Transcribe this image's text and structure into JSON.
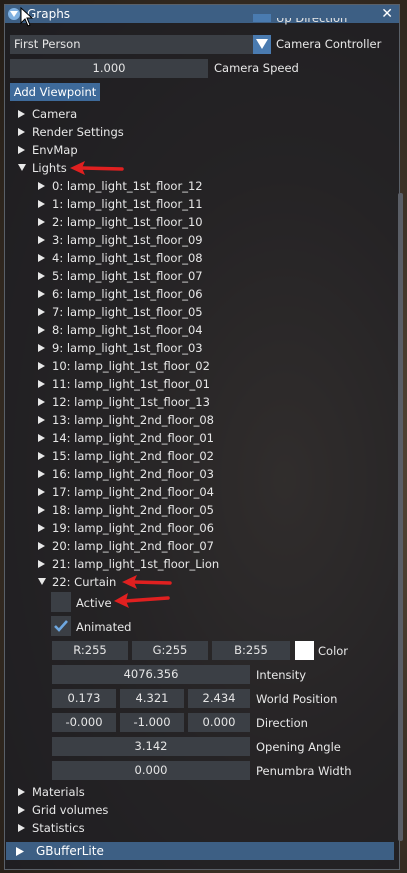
{
  "window": {
    "title": "Graphs",
    "close_glyph": "✕"
  },
  "top": {
    "up_direction_label": "Up Direction",
    "camera_controller_value": "First Person",
    "camera_controller_label": "Camera Controller",
    "camera_speed_value": "1.000",
    "camera_speed_label": "Camera Speed",
    "add_viewpoint_label": "Add Viewpoint"
  },
  "sections": {
    "camera": "Camera",
    "render_settings": "Render Settings",
    "envmap": "EnvMap",
    "lights": "Lights",
    "materials": "Materials",
    "grid_volumes": "Grid volumes",
    "statistics": "Statistics"
  },
  "lights": [
    "0: lamp_light_1st_floor_12",
    "1: lamp_light_1st_floor_11",
    "2: lamp_light_1st_floor_10",
    "3: lamp_light_1st_floor_09",
    "4: lamp_light_1st_floor_08",
    "5: lamp_light_1st_floor_07",
    "6: lamp_light_1st_floor_06",
    "7: lamp_light_1st_floor_05",
    "8: lamp_light_1st_floor_04",
    "9: lamp_light_1st_floor_03",
    "10: lamp_light_1st_floor_02",
    "11: lamp_light_1st_floor_01",
    "12: lamp_light_1st_floor_13",
    "13: lamp_light_2nd_floor_08",
    "14: lamp_light_2nd_floor_01",
    "15: lamp_light_2nd_floor_02",
    "16: lamp_light_2nd_floor_03",
    "17: lamp_light_2nd_floor_04",
    "18: lamp_light_2nd_floor_05",
    "19: lamp_light_2nd_floor_06",
    "20: lamp_light_2nd_floor_07",
    "21: lamp_light_1st_floor_Lion"
  ],
  "curtain": {
    "name": "22: Curtain",
    "active_label": "Active",
    "active_checked": false,
    "animated_label": "Animated",
    "animated_checked": true,
    "color_r": "R:255",
    "color_g": "G:255",
    "color_b": "B:255",
    "color_label": "Color",
    "color_swatch": "#ffffff",
    "intensity_value": "4076.356",
    "intensity_label": "Intensity",
    "world_position": [
      "0.173",
      "4.321",
      "2.434"
    ],
    "world_position_label": "World Position",
    "direction": [
      "-0.000",
      "-1.000",
      "0.000"
    ],
    "direction_label": "Direction",
    "opening_angle_value": "3.142",
    "opening_angle_label": "Opening Angle",
    "penumbra_width_value": "0.000",
    "penumbra_width_label": "Penumbra Width"
  },
  "bottom_panel": {
    "title": "GBufferLite"
  },
  "colors": {
    "title_bar": "#3d5f84",
    "field_bg": "#3b3f45",
    "accent_blue": "#4a7bb0",
    "annotation_red": "#e02020"
  }
}
